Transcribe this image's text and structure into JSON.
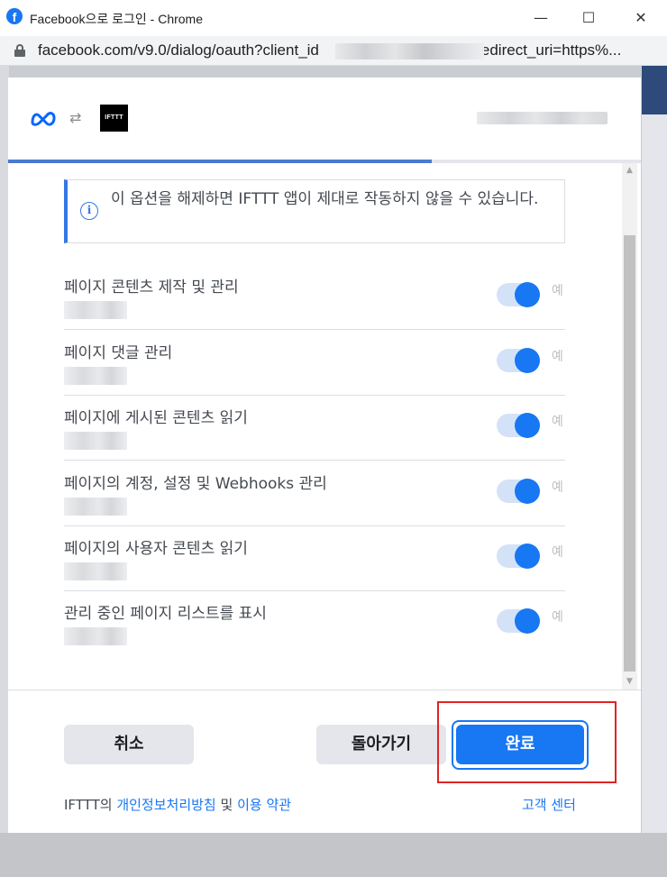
{
  "window": {
    "title": "Facebook으로 로그인 - Chrome",
    "favicon": "f",
    "minimize": "—",
    "maximize": "☐",
    "close": "✕"
  },
  "address": {
    "url_prefix": "facebook.com/v9.0/dialog/oauth?client_id",
    "url_suffix": "&redirect_uri=https%..."
  },
  "header": {
    "swap_icon": "⇄",
    "app_logo_text": "IFTTT"
  },
  "notice": {
    "icon": "i",
    "text": "이 옵션을 해제하면 IFTTT 앱이 제대로 작동하지 않을 수 있습니다."
  },
  "permissions": [
    {
      "title": "페이지 콘텐츠 제작 및 관리",
      "toggle_label": "예",
      "enabled": true
    },
    {
      "title": "페이지 댓글 관리",
      "toggle_label": "예",
      "enabled": true
    },
    {
      "title": "페이지에 게시된 콘텐츠 읽기",
      "toggle_label": "예",
      "enabled": true
    },
    {
      "title": "페이지의 계정, 설정 및 Webhooks 관리",
      "toggle_label": "예",
      "enabled": true
    },
    {
      "title": "페이지의 사용자 콘텐츠 읽기",
      "toggle_label": "예",
      "enabled": true
    },
    {
      "title": "관리 중인 페이지 리스트를 표시",
      "toggle_label": "예",
      "enabled": true
    }
  ],
  "progress": 0.67,
  "scrollbar": {
    "up": "▲",
    "down": "▼"
  },
  "buttons": {
    "cancel": "취소",
    "back": "돌아가기",
    "done": "완료"
  },
  "footer": {
    "prefix": "IFTTT의 ",
    "privacy_link": "개인정보처리방침",
    "and": " 및 ",
    "terms_link": "이용 약관",
    "help_link": "고객 센터"
  },
  "colors": {
    "primary": "#1877f2",
    "highlight": "#e02424"
  }
}
